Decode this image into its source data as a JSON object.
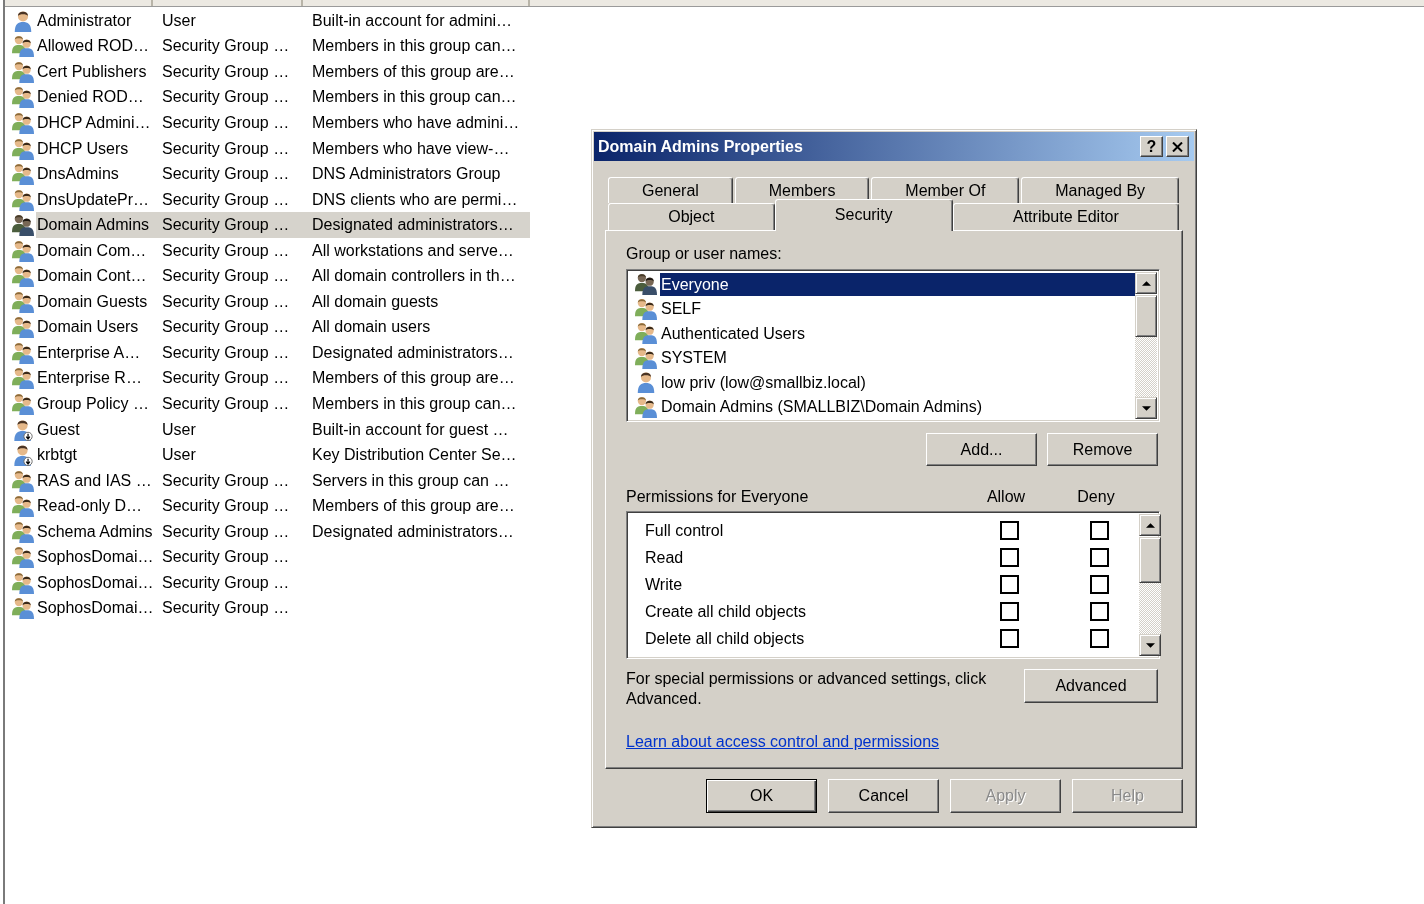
{
  "list": {
    "rows": [
      {
        "kind": "user",
        "name": "Administrator",
        "type": "User",
        "description": "Built-in account for admini…",
        "selected": false
      },
      {
        "kind": "group",
        "name": "Allowed ROD…",
        "type": "Security Group …",
        "description": "Members in this group can…",
        "selected": false
      },
      {
        "kind": "group",
        "name": "Cert Publishers",
        "type": "Security Group …",
        "description": "Members of this group are…",
        "selected": false
      },
      {
        "kind": "group",
        "name": "Denied ROD…",
        "type": "Security Group …",
        "description": "Members in this group can…",
        "selected": false
      },
      {
        "kind": "group",
        "name": "DHCP Admini…",
        "type": "Security Group …",
        "description": "Members who have admini…",
        "selected": false
      },
      {
        "kind": "group",
        "name": "DHCP Users",
        "type": "Security Group …",
        "description": "Members who have view-…",
        "selected": false
      },
      {
        "kind": "group",
        "name": "DnsAdmins",
        "type": "Security Group …",
        "description": "DNS Administrators Group",
        "selected": false
      },
      {
        "kind": "group",
        "name": "DnsUpdatePr…",
        "type": "Security Group …",
        "description": "DNS clients who are permi…",
        "selected": false
      },
      {
        "kind": "group",
        "name": "Domain Admins",
        "type": "Security Group …",
        "description": "Designated administrators…",
        "selected": true
      },
      {
        "kind": "group",
        "name": "Domain Com…",
        "type": "Security Group …",
        "description": "All workstations and serve…",
        "selected": false
      },
      {
        "kind": "group",
        "name": "Domain Cont…",
        "type": "Security Group …",
        "description": "All domain controllers in th…",
        "selected": false
      },
      {
        "kind": "group",
        "name": "Domain Guests",
        "type": "Security Group …",
        "description": "All domain guests",
        "selected": false
      },
      {
        "kind": "group",
        "name": "Domain Users",
        "type": "Security Group …",
        "description": "All domain users",
        "selected": false
      },
      {
        "kind": "group",
        "name": "Enterprise A…",
        "type": "Security Group …",
        "description": "Designated administrators…",
        "selected": false
      },
      {
        "kind": "group",
        "name": "Enterprise R…",
        "type": "Security Group …",
        "description": "Members of this group are…",
        "selected": false
      },
      {
        "kind": "group",
        "name": "Group Policy …",
        "type": "Security Group …",
        "description": "Members in this group can…",
        "selected": false
      },
      {
        "kind": "user-disabled",
        "name": "Guest",
        "type": "User",
        "description": "Built-in account for guest …",
        "selected": false
      },
      {
        "kind": "user-disabled",
        "name": "krbtgt",
        "type": "User",
        "description": "Key Distribution Center Se…",
        "selected": false
      },
      {
        "kind": "group",
        "name": "RAS and IAS …",
        "type": "Security Group …",
        "description": "Servers in this group can …",
        "selected": false
      },
      {
        "kind": "group",
        "name": "Read-only D…",
        "type": "Security Group …",
        "description": "Members of this group are…",
        "selected": false
      },
      {
        "kind": "group",
        "name": "Schema Admins",
        "type": "Security Group …",
        "description": "Designated administrators…",
        "selected": false
      },
      {
        "kind": "group",
        "name": "SophosDomai…",
        "type": "Security Group …",
        "selected": false
      },
      {
        "kind": "group",
        "name": "SophosDomai…",
        "type": "Security Group …",
        "selected": false
      },
      {
        "kind": "group",
        "name": "SophosDomai…",
        "type": "Security Group …",
        "selected": false
      }
    ]
  },
  "dialog": {
    "title": "Domain Admins Properties",
    "help_button": "?",
    "tab_rows": [
      {
        "tabs": [
          {
            "label": "General",
            "selected": false
          },
          {
            "label": "Members",
            "selected": false
          },
          {
            "label": "Member Of",
            "selected": false
          },
          {
            "label": "Managed By",
            "selected": false
          }
        ]
      },
      {
        "tabs": [
          {
            "label": "Object",
            "selected": false
          },
          {
            "label": "Security",
            "selected": true
          },
          {
            "label": "Attribute Editor",
            "selected": false
          }
        ]
      }
    ],
    "group_list": {
      "label": "Group or user names:",
      "items": [
        {
          "kind": "group",
          "name": "Everyone",
          "selected": true
        },
        {
          "kind": "group",
          "name": "SELF",
          "selected": false
        },
        {
          "kind": "group",
          "name": "Authenticated Users",
          "selected": false
        },
        {
          "kind": "group",
          "name": "SYSTEM",
          "selected": false
        },
        {
          "kind": "user",
          "name": "low priv (low@smallbiz.local)",
          "selected": false
        },
        {
          "kind": "group",
          "name": "Domain Admins (SMALLBIZ\\Domain Admins)",
          "selected": false
        }
      ]
    },
    "list_buttons": [
      "Add...",
      "Remove"
    ],
    "permissions": {
      "label": "Permissions for Everyone",
      "allow_label": "Allow",
      "deny_label": "Deny",
      "rows": [
        {
          "name": "Full control",
          "allow": false,
          "deny": false
        },
        {
          "name": "Read",
          "allow": false,
          "deny": false
        },
        {
          "name": "Write",
          "allow": false,
          "deny": false
        },
        {
          "name": "Create all child objects",
          "allow": false,
          "deny": false
        },
        {
          "name": "Delete all child objects",
          "allow": false,
          "deny": false
        }
      ]
    },
    "advanced_text": "For special permissions or advanced settings, click Advanced.",
    "advanced_button": "Advanced",
    "link": "Learn about access control and permissions",
    "buttons": [
      {
        "label": "OK",
        "default": true,
        "disabled": false
      },
      {
        "label": "Cancel",
        "default": false,
        "disabled": false
      },
      {
        "label": "Apply",
        "default": false,
        "disabled": true
      },
      {
        "label": "Help",
        "default": false,
        "disabled": true
      }
    ]
  }
}
